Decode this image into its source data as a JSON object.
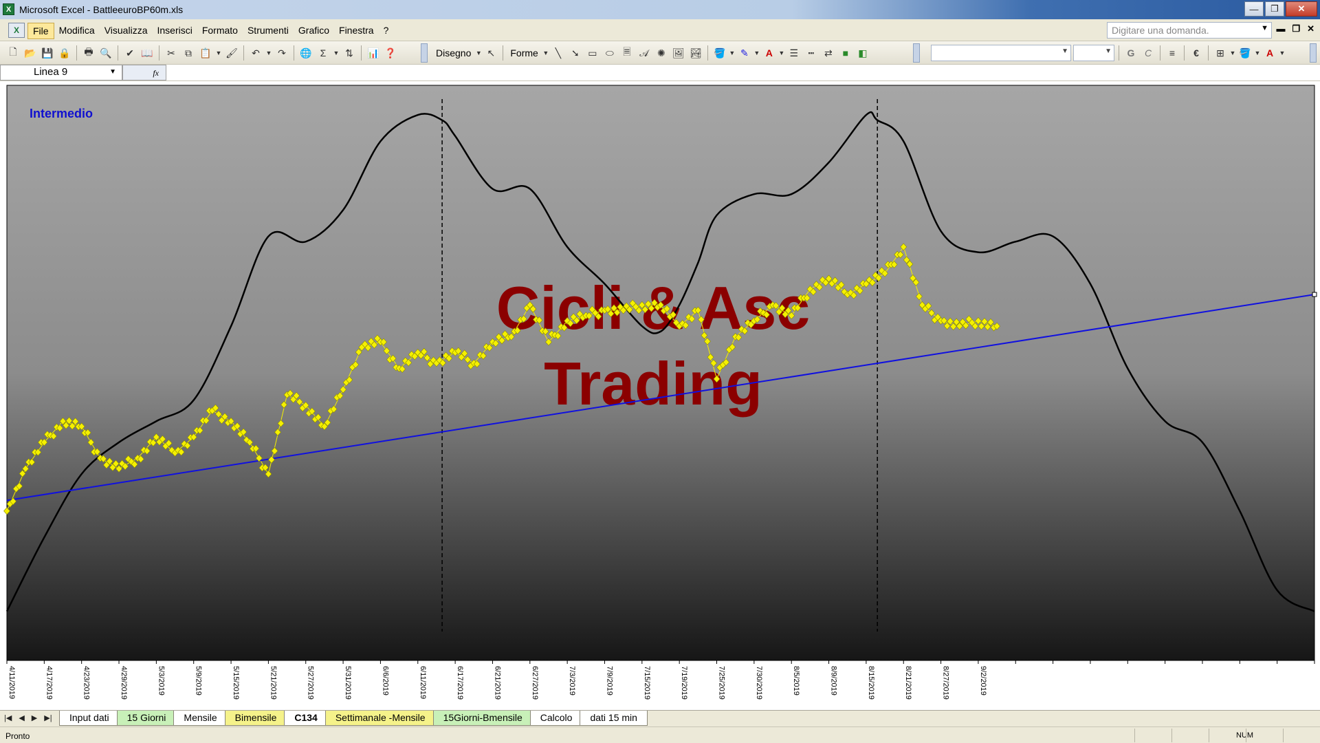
{
  "window": {
    "app_icon": "excel-icon",
    "title": "Microsoft Excel - BattleeuroBP60m.xls",
    "buttons": [
      "minimize-icon",
      "restore-icon",
      "close-icon"
    ],
    "close_glyph": "✕",
    "min_glyph": "—",
    "restore_glyph": "❐"
  },
  "menu": {
    "items": [
      "File",
      "Modifica",
      "Visualizza",
      "Inserisci",
      "Formato",
      "Strumenti",
      "Grafico",
      "Finestra",
      "?"
    ],
    "active_index": 0,
    "help_placeholder": "Digitare una domanda.",
    "mdi_buttons": [
      "▬",
      "❐",
      "✕"
    ]
  },
  "toolbar": {
    "draw_label": "Disegno",
    "shapes_label": "Forme",
    "font_bold": "G",
    "font_cursive": "C",
    "euro": "€"
  },
  "formula_bar": {
    "name_box": "Linea 9",
    "fx": "fx"
  },
  "chart": {
    "label": "Intermedio",
    "watermark_line1": "Cicli & Asc",
    "watermark_line2": "Trading",
    "colors": {
      "price": "#f5f000",
      "price_edge": "#8a8a00",
      "cycle": "#000000",
      "trend": "#1010e0",
      "label": "#1010d0",
      "watermark": "#8b0000"
    }
  },
  "chart_data": {
    "type": "line",
    "x_tick_labels": [
      "4/11/2019",
      "4/17/2019",
      "4/23/2019",
      "4/29/2019",
      "5/3/2019",
      "5/9/2019",
      "5/15/2019",
      "5/21/2019",
      "5/27/2019",
      "5/31/2019",
      "6/6/2019",
      "6/11/2019",
      "6/17/2019",
      "6/21/2019",
      "6/27/2019",
      "7/3/2019",
      "7/9/2019",
      "7/15/2019",
      "7/19/2019",
      "7/25/2019",
      "7/30/2019",
      "8/5/2019",
      "8/9/2019",
      "8/15/2019",
      "8/21/2019",
      "8/27/2019",
      "9/2/2019"
    ],
    "x_index_range": [
      0,
      35
    ],
    "ylim": [
      0,
      100
    ],
    "grid": false,
    "dashed_vlines_at_index": [
      11.65,
      23.3
    ],
    "series": [
      {
        "kind": "markers",
        "x": [
          0,
          0.5,
          1,
          1.5,
          2,
          2.5,
          3,
          3.5,
          4,
          4.5,
          5,
          5.5,
          6,
          6.5,
          7,
          7.5,
          8,
          8.5,
          9,
          9.5,
          10,
          10.5,
          11,
          11.5,
          12,
          12.5,
          13,
          13.5,
          14,
          14.5,
          15,
          15.5,
          16,
          16.5,
          17,
          17.5,
          18,
          18.5,
          19,
          19.5,
          20,
          20.5,
          21,
          21.5,
          22,
          22.5,
          23,
          23.5,
          24,
          24.5,
          25,
          25.5,
          26,
          26.5
        ],
        "values": [
          27,
          35,
          40,
          44,
          43,
          37,
          35,
          37,
          41,
          38,
          41,
          46,
          44,
          40,
          34,
          49,
          47,
          43,
          50,
          58,
          59,
          54,
          57,
          55,
          57,
          55,
          59,
          60,
          66,
          59,
          63,
          64,
          65,
          65,
          66,
          66,
          62,
          65,
          52,
          60,
          63,
          66,
          64,
          69,
          71,
          68,
          70,
          72,
          77,
          66,
          63,
          62,
          63,
          62
        ]
      },
      {
        "kind": "line",
        "x": [
          0,
          1,
          2,
          3,
          4,
          5,
          6,
          7,
          8,
          9,
          10,
          11,
          11.65,
          12,
          13,
          14,
          15,
          16,
          17,
          17.5,
          18,
          18.5,
          19,
          20,
          21,
          22,
          23,
          23.3,
          24,
          25,
          26,
          27,
          28,
          29,
          30,
          31,
          32,
          33,
          34,
          35
        ],
        "values": [
          8,
          22,
          34,
          40,
          44,
          48,
          62,
          79,
          78,
          84,
          97,
          102,
          101,
          98,
          88,
          88,
          77,
          70,
          62,
          61,
          66,
          74,
          83,
          87,
          87,
          93,
          102,
          101,
          97,
          80,
          76,
          78,
          79,
          70,
          54,
          44,
          40,
          27,
          12,
          8
        ]
      },
      {
        "kind": "line",
        "x": [
          0,
          35
        ],
        "values": [
          29,
          68
        ]
      }
    ]
  },
  "sheet_tabs": [
    {
      "label": "Input dati",
      "color": "white"
    },
    {
      "label": "15 Giorni",
      "color": "green"
    },
    {
      "label": "Mensile",
      "color": "white"
    },
    {
      "label": "Bimensile",
      "color": "yellow"
    },
    {
      "label": "C134",
      "color": "active"
    },
    {
      "label": "Settimanale -Mensile",
      "color": "yellow"
    },
    {
      "label": "15Giorni-Bmensile",
      "color": "green"
    },
    {
      "label": "Calcolo",
      "color": "white"
    },
    {
      "label": "dati 15 min",
      "color": "white"
    }
  ],
  "status": {
    "left": "Pronto",
    "num": "NUM"
  }
}
